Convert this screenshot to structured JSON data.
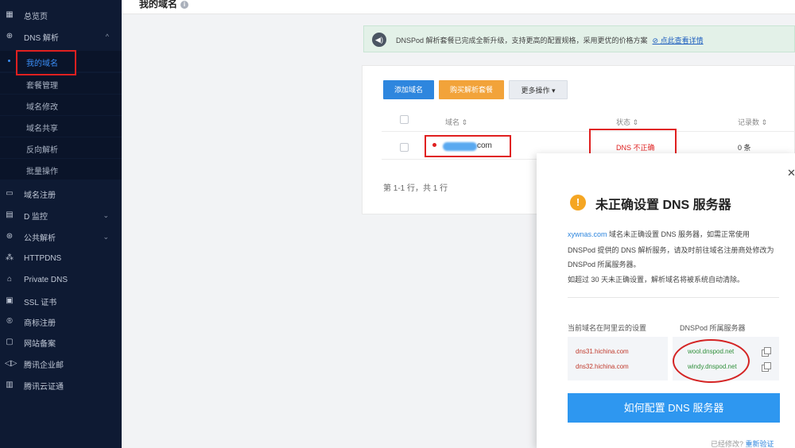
{
  "sidebar": {
    "items": [
      {
        "label": "总览页",
        "icon": "grid-icon"
      },
      {
        "label": "DNS 解析",
        "icon": "globe-icon"
      },
      {
        "label": "域名注册",
        "icon": "calendar-icon"
      },
      {
        "label": "D 监控",
        "icon": "monitor-icon"
      },
      {
        "label": "公共解析",
        "icon": "public-globe-icon"
      },
      {
        "label": "HTTPDNS",
        "icon": "network-icon"
      },
      {
        "label": "Private DNS",
        "icon": "building-icon"
      },
      {
        "label": "SSL 证书",
        "icon": "certificate-icon"
      },
      {
        "label": "商标注册",
        "icon": "trademark-icon"
      },
      {
        "label": "网站备案",
        "icon": "filing-icon"
      },
      {
        "label": "腾讯企业邮",
        "icon": "mail-icon"
      },
      {
        "label": "腾讯云证通",
        "icon": "id-card-icon"
      }
    ],
    "dns_sub": [
      "我的域名",
      "套餐管理",
      "域名修改",
      "域名共享",
      "反向解析",
      "批量操作"
    ]
  },
  "header": {
    "title": "我的域名"
  },
  "notice": {
    "text": "DNSPod 解析套餐已完成全新升级，支持更高的配置规格，采用更优的价格方案",
    "link": "点此查看详情"
  },
  "toolbar": {
    "add": "添加域名",
    "buy": "购买解析套餐",
    "more": "更多操作 ▾"
  },
  "table": {
    "headers": {
      "domain": "域名 ⇕",
      "status": "状态 ⇕",
      "records": "记录数 ⇕"
    },
    "row": {
      "domain": "com",
      "status": "DNS 不正确",
      "records": "0 条"
    },
    "pagination": "第 1-1 行，共 1 行"
  },
  "modal": {
    "title": "未正确设置 DNS 服务器",
    "desc_domain": "xywnas.com",
    "desc_1": "域名未正确设置 DNS 服务器，如需正常使用",
    "desc_2": "DNSPod 提供的 DNS 解析服务，请及时前往域名注册商处修改为",
    "desc_3": "DNSPod 所属服务器。",
    "desc_4": "如超过 30 天未正确设置，解析域名将被系统自动清除。",
    "col_current": "当前域名在阿里云的设置",
    "col_dnspod": "DNSPod 所属服务器",
    "current_ns": [
      "dns31.hichina.com",
      "dns32.hichina.com"
    ],
    "dnspod_ns": [
      "wool.dnspod.net",
      "windy.dnspod.net"
    ],
    "button": "如何配置 DNS 服务器",
    "footer_q": "已经修改?",
    "footer_link": "重新验证"
  }
}
